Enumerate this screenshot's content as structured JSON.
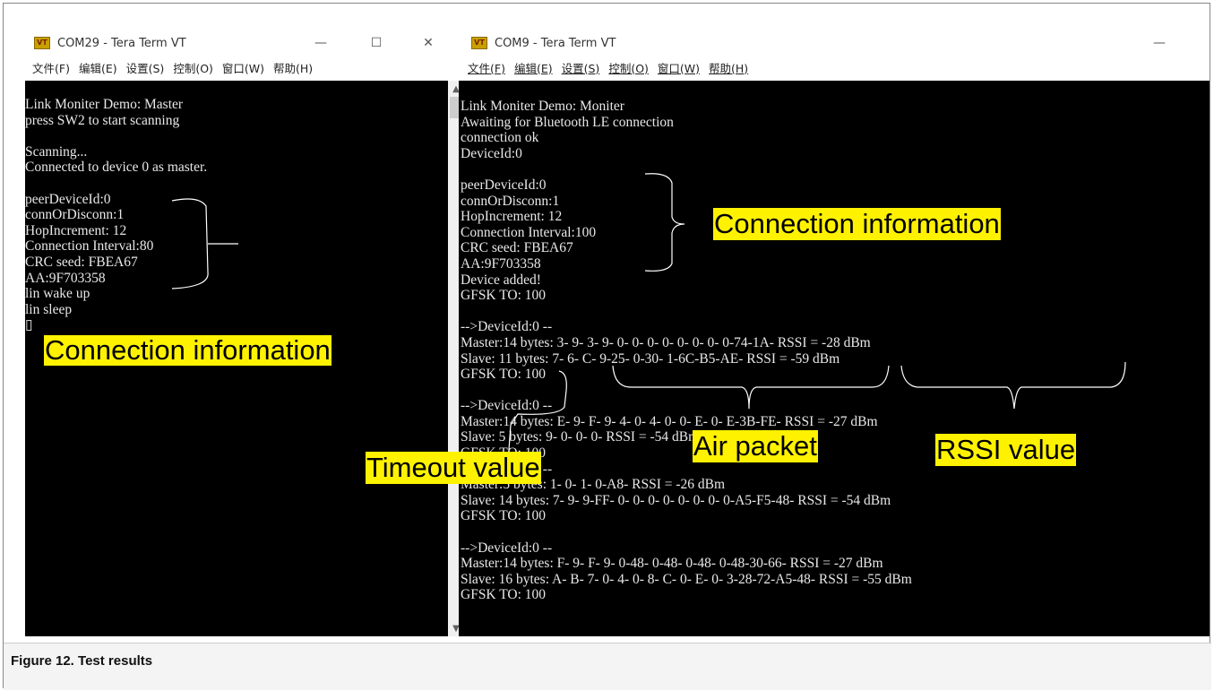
{
  "left_window": {
    "title": "COM29 - Tera Term VT",
    "icon": "VT",
    "controls": [
      "—",
      "☐",
      "✕"
    ],
    "menu": [
      "文件(F)",
      "编辑(E)",
      "设置(S)",
      "控制(O)",
      "窗口(W)",
      "帮助(H)"
    ],
    "lines": [
      "Link Moniter Demo: Master",
      "press SW2 to start scanning",
      "",
      "Scanning...",
      "Connected to device 0 as master.",
      "",
      "peerDeviceId:0",
      "connOrDisconn:1",
      "HopIncrement: 12",
      "Connection Interval:80",
      "CRC seed: FBEA67",
      "AA:9F703358",
      "lin wake up",
      "lin sleep",
      "▯"
    ]
  },
  "right_window": {
    "title": "COM9 - Tera Term VT",
    "icon": "VT",
    "controls": [
      "—"
    ],
    "menu": [
      "文件(F)",
      "编辑(E)",
      "设置(S)",
      "控制(O)",
      "窗口(W)",
      "帮助(H)"
    ],
    "lines": [
      "Link Moniter Demo: Moniter",
      "Awaiting for Bluetooth LE connection",
      "connection ok",
      "DeviceId:0",
      "",
      "peerDeviceId:0",
      "connOrDisconn:1",
      "HopIncrement: 12",
      "Connection Interval:100",
      "CRC seed: FBEA67",
      "AA:9F703358",
      "Device added!",
      "GFSK TO: 100",
      "",
      "-->DeviceId:0 --",
      "Master:14 bytes: 3- 9- 3- 9- 0- 0- 0- 0- 0- 0- 0- 0-74-1A- RSSI = -28 dBm",
      "Slave: 11 bytes: 7- 6- C- 9-25- 0-30- 1-6C-B5-AE- RSSI = -59 dBm",
      "GFSK TO: 100",
      "",
      "-->DeviceId:0 --",
      "Master:14 bytes: E- 9- F- 9- 4- 0- 4- 0- 0- E- 0- E-3B-FE- RSSI = -27 dBm",
      "Slave: 5 bytes: 9- 0- 0- 0- RSSI = -54 dBm",
      "GFSK TO: 100",
      "-->DeviceId:0 --",
      "Master:5 bytes: 1- 0- 1- 0-A8- RSSI = -26 dBm",
      "Slave: 14 bytes: 7- 9- 9-FF- 0- 0- 0- 0- 0- 0- 0- 0-A5-F5-48- RSSI = -54 dBm",
      "GFSK TO: 100",
      "",
      "-->DeviceId:0 --",
      "Master:14 bytes: F- 9- F- 9- 0-48- 0-48- 0-48- 0-48-30-66- RSSI = -27 dBm",
      "Slave: 16 bytes: A- B- 7- 0- 4- 0- 8- C- 0- E- 0- 3-28-72-A5-48- RSSI = -55 dBm",
      "GFSK TO: 100"
    ]
  },
  "annotations": {
    "left_connection_info": "Connection information",
    "right_connection_info": "Connection information",
    "air_packet": "Air packet",
    "rssi_value": "RSSI value",
    "timeout_value": "Timeout value"
  },
  "caption": "Figure 12. Test results"
}
